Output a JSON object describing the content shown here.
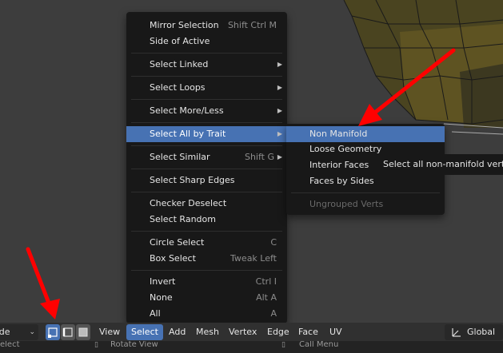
{
  "menu": {
    "items": [
      {
        "label": "Mirror Selection",
        "shortcut": "Shift Ctrl M"
      },
      {
        "label": "Side of Active",
        "shortcut": ""
      },
      {
        "label": "Select Linked",
        "shortcut": "",
        "submenu": true
      },
      {
        "label": "Select Loops",
        "shortcut": "",
        "submenu": true
      },
      {
        "label": "Select More/Less",
        "shortcut": "",
        "submenu": true
      },
      {
        "label": "Select All by Trait",
        "shortcut": "",
        "submenu": true,
        "active": true
      },
      {
        "label": "Select Similar",
        "shortcut": "Shift G",
        "submenu": true
      },
      {
        "label": "Select Sharp Edges",
        "shortcut": ""
      },
      {
        "label": "Checker Deselect",
        "shortcut": ""
      },
      {
        "label": "Select Random",
        "shortcut": ""
      },
      {
        "label": "Circle Select",
        "shortcut": "C"
      },
      {
        "label": "Box Select",
        "shortcut": "Tweak Left"
      },
      {
        "label": "Invert",
        "shortcut": "Ctrl I"
      },
      {
        "label": "None",
        "shortcut": "Alt A"
      },
      {
        "label": "All",
        "shortcut": "A"
      }
    ]
  },
  "submenu": {
    "items": [
      {
        "label": "Non Manifold",
        "active": true
      },
      {
        "label": "Loose Geometry"
      },
      {
        "label": "Interior Faces"
      },
      {
        "label": "Faces by Sides"
      },
      {
        "label": "Ungrouped Verts",
        "disabled": true
      }
    ]
  },
  "tooltip": {
    "text": "Select all non-manifold vertices"
  },
  "header": {
    "mode_label": "ode",
    "menus": [
      "View",
      "Select",
      "Add",
      "Mesh",
      "Vertex",
      "Edge",
      "Face",
      "UV"
    ],
    "active_menu": "Select",
    "orientation_label": "Global"
  },
  "status": {
    "left": "elect",
    "middle": "Rotate View",
    "right": "Call Menu"
  },
  "colors": {
    "accent": "#4772b3",
    "menu_bg": "#181818",
    "arrow": "#ff0000"
  }
}
